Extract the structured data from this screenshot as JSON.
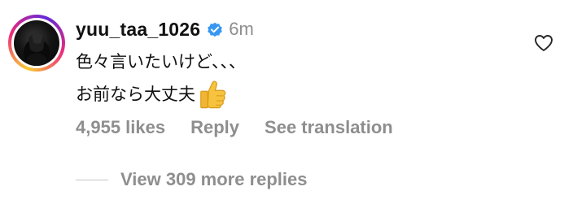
{
  "comment": {
    "username": "yuu_taa_1026",
    "verified_icon": "verified-badge-icon",
    "time": "6m",
    "lines": [
      "色々言いたいけど、、、",
      "お前なら大丈夫"
    ],
    "emoji_icon": "thumbs-up-icon",
    "likes": "4,955 likes",
    "reply_label": "Reply",
    "translation_label": "See translation",
    "more_replies_label": "View 309 more replies",
    "like_icon": "heart-outline-icon"
  },
  "colors": {
    "verified": "#3897f0",
    "muted": "#8e8e8e",
    "text": "#111111"
  }
}
